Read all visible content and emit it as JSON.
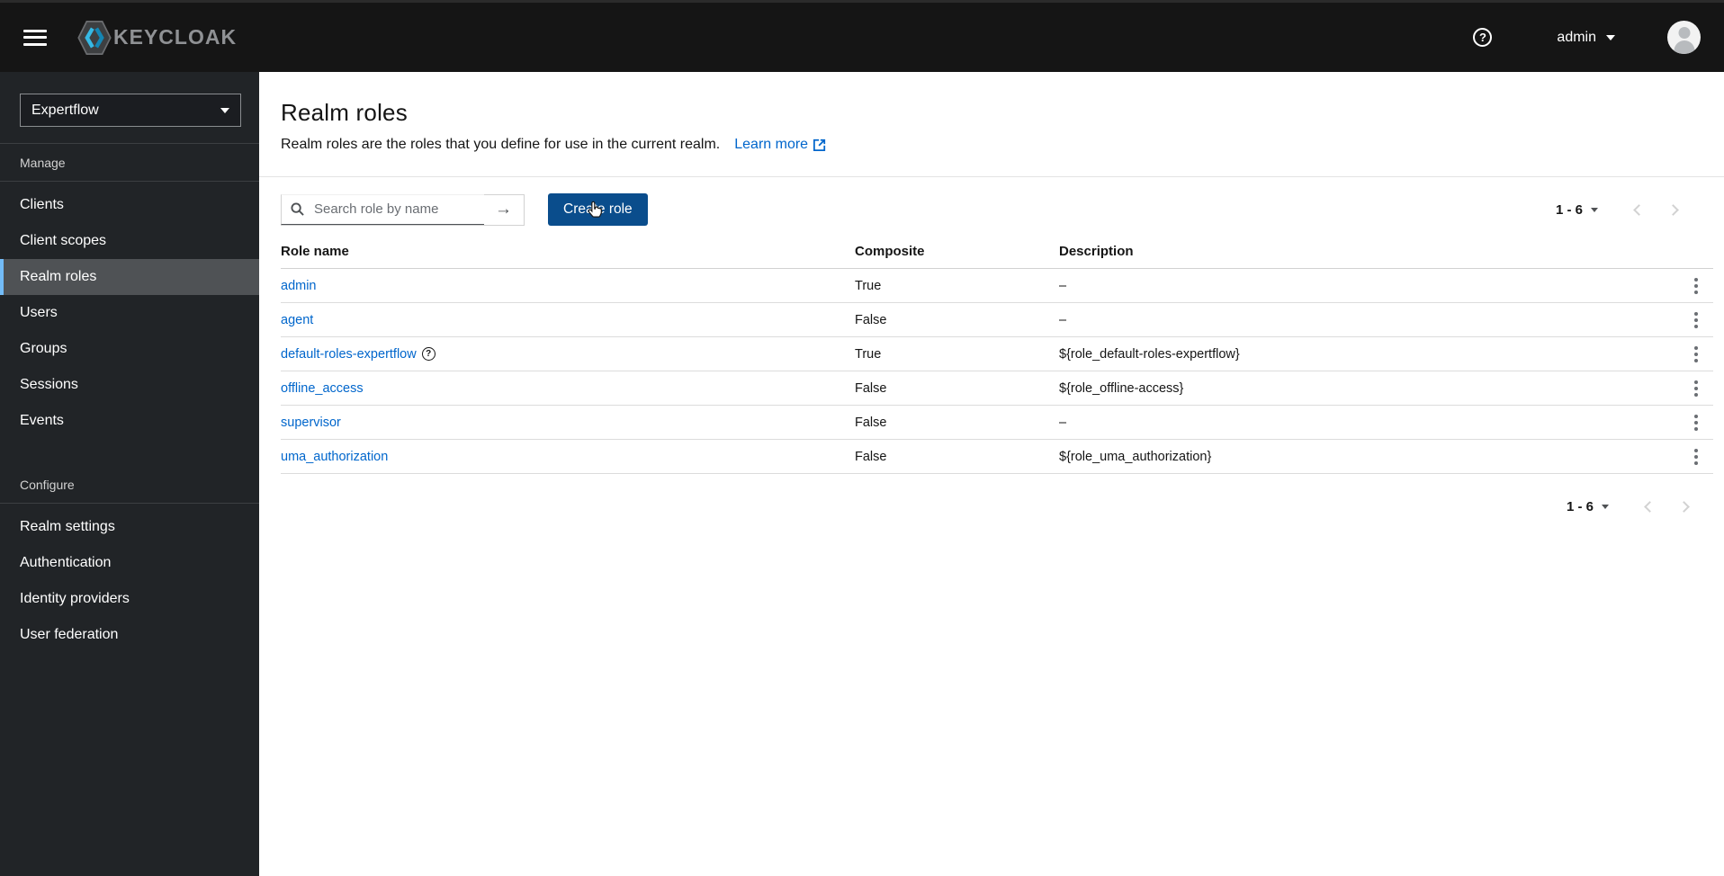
{
  "masthead": {
    "brand": "KEYCLOAK",
    "user": "admin"
  },
  "sidebar": {
    "realm": "Expertflow",
    "sections": [
      {
        "label": "Manage",
        "items": [
          {
            "label": "Clients",
            "current": false
          },
          {
            "label": "Client scopes",
            "current": false
          },
          {
            "label": "Realm roles",
            "current": true
          },
          {
            "label": "Users",
            "current": false
          },
          {
            "label": "Groups",
            "current": false
          },
          {
            "label": "Sessions",
            "current": false
          },
          {
            "label": "Events",
            "current": false
          }
        ]
      },
      {
        "label": "Configure",
        "items": [
          {
            "label": "Realm settings",
            "current": false
          },
          {
            "label": "Authentication",
            "current": false
          },
          {
            "label": "Identity providers",
            "current": false
          },
          {
            "label": "User federation",
            "current": false
          }
        ]
      }
    ]
  },
  "page": {
    "title": "Realm roles",
    "description": "Realm roles are the roles that you define for use in the current realm.",
    "learn_more_label": "Learn more"
  },
  "toolbar": {
    "search_placeholder": "Search role by name",
    "create_label": "Create role"
  },
  "pagination": {
    "range": "1 - 6"
  },
  "table": {
    "headers": [
      "Role name",
      "Composite",
      "Description"
    ],
    "rows": [
      {
        "name": "admin",
        "composite": "True",
        "description": "–",
        "help": false
      },
      {
        "name": "agent",
        "composite": "False",
        "description": "–",
        "help": false
      },
      {
        "name": "default-roles-expertflow",
        "composite": "True",
        "description": "${role_default-roles-expertflow}",
        "help": true
      },
      {
        "name": "offline_access",
        "composite": "False",
        "description": "${role_offline-access}",
        "help": false
      },
      {
        "name": "supervisor",
        "composite": "False",
        "description": "–",
        "help": false
      },
      {
        "name": "uma_authorization",
        "composite": "False",
        "description": "${role_uma_authorization}",
        "help": false
      }
    ]
  },
  "colors": {
    "accent_link": "#0066cc",
    "masthead_bg": "#151515",
    "sidebar_bg": "#212427",
    "nav_selected_bg": "#4f5255",
    "nav_selected_border": "#73bcf7",
    "primary_button_bg": "#0a4d8c",
    "disabled_chevron": "#d2d2d2"
  }
}
